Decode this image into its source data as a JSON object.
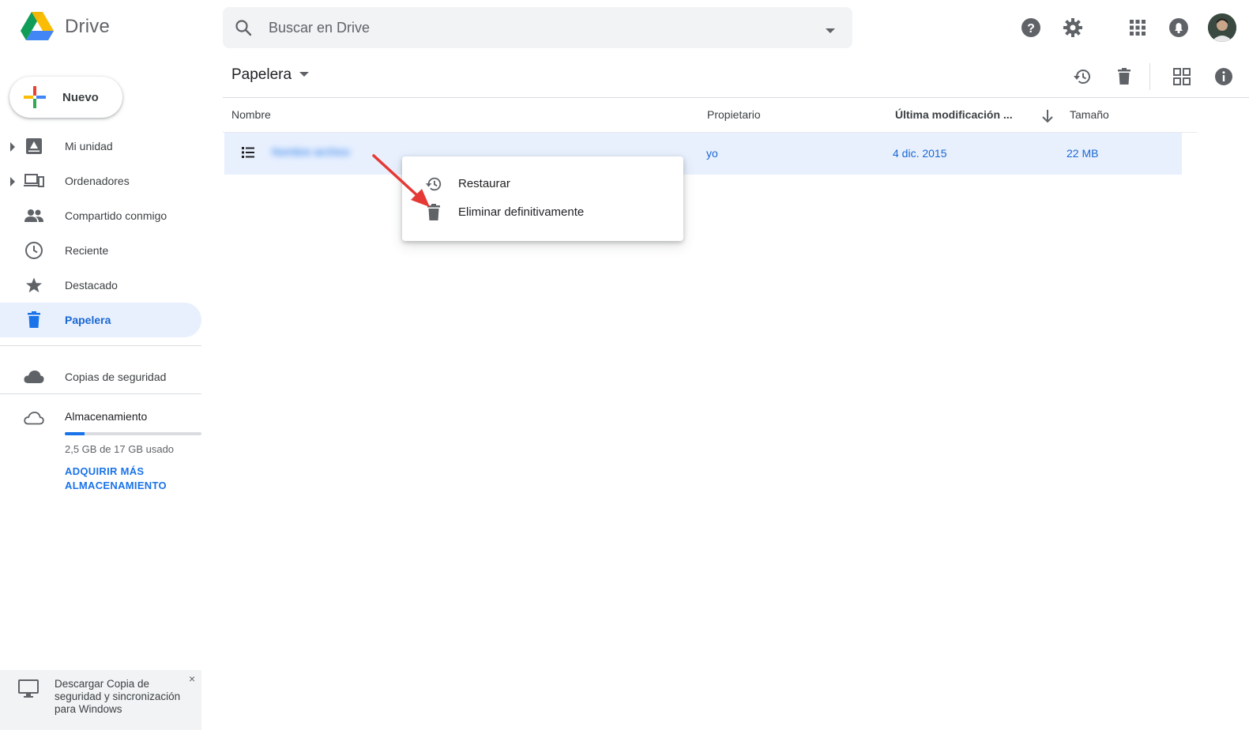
{
  "header": {
    "app_name": "Drive",
    "search_placeholder": "Buscar en Drive"
  },
  "sidebar": {
    "new_button": "Nuevo",
    "items": [
      {
        "label": "Mi unidad"
      },
      {
        "label": "Ordenadores"
      },
      {
        "label": "Compartido conmigo"
      },
      {
        "label": "Reciente"
      },
      {
        "label": "Destacado"
      },
      {
        "label": "Papelera",
        "active": true
      }
    ],
    "backups": "Copias de seguridad",
    "storage": {
      "label": "Almacenamiento",
      "used_text": "2,5 GB de 17 GB usado",
      "used_fraction": 0.147,
      "buy_link": "ADQUIRIR MÁS ALMACENAMIENTO"
    },
    "promo": {
      "text": "Descargar Copia de seguridad y sincronización para Windows",
      "close": "×"
    }
  },
  "main": {
    "title": "Papelera",
    "columns": {
      "name": "Nombre",
      "owner": "Propietario",
      "modified": "Última modificación ...",
      "size": "Tamaño"
    },
    "rows": [
      {
        "name": "Nombre archivo",
        "owner": "yo",
        "modified": "4 dic. 2015",
        "size": "22 MB"
      }
    ]
  },
  "context_menu": {
    "items": [
      {
        "label": "Restaurar",
        "icon": "restore-icon"
      },
      {
        "label": "Eliminar definitivamente",
        "icon": "trash-icon"
      }
    ]
  },
  "colors": {
    "accent": "#1a73e8",
    "active_bg": "#e8f0fe",
    "annotation_arrow": "#e53935"
  }
}
